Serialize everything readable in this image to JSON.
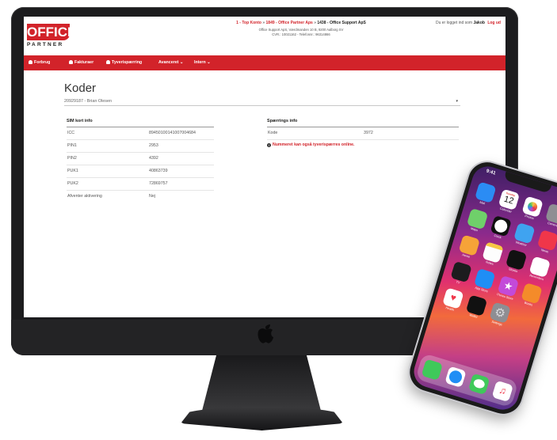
{
  "header": {
    "logo_main": "OFFICE",
    "logo_sub": "PARTNER",
    "breadcrumb": {
      "part1": "1 - Top Konto",
      "sep1": " » ",
      "part2": "1849 - Office Partner Aps",
      "sep2": " » ",
      "part3": "1438 - Office Support ApS"
    },
    "address_line1": "Office Support ApS, Værdmanden 10 B, 9200 Aalborg SV",
    "address_line2": "CVR.: 10021162 - Telefonnr.: 96314866",
    "logged_in_text": "Du er logget ind som",
    "user_name": "Jakob",
    "logout_label": "Log ud"
  },
  "nav": {
    "items": [
      {
        "label": "Forbrug"
      },
      {
        "label": "Fakturaer"
      },
      {
        "label": "Tyverispærring"
      },
      {
        "label": "Avanceret ⌄"
      },
      {
        "label": "Intern ⌄"
      }
    ]
  },
  "main": {
    "title": "Koder",
    "selected_subscriber": "20929187 - Brian Olesen",
    "sim_panel": {
      "heading": "SIM kort info",
      "rows": [
        {
          "label": "ICC",
          "value": "89450100141007004684"
        },
        {
          "label": "PIN1",
          "value": "2953"
        },
        {
          "label": "PIN2",
          "value": "4392"
        },
        {
          "label": "PUK1",
          "value": "40863739"
        },
        {
          "label": "PUK2",
          "value": "72869757"
        },
        {
          "label": "Afventer aktivering",
          "value": "Nej"
        }
      ]
    },
    "block_panel": {
      "heading": "Spærrings info",
      "rows": [
        {
          "label": "Kode",
          "value": "3972"
        }
      ],
      "note": "Nummeret kan også tyverispærres online."
    }
  },
  "phone": {
    "time": "9:41",
    "calendar_day": "Tuesday",
    "calendar_date": "12",
    "apps": [
      "Mail",
      "Calendar",
      "Photos",
      "Camera",
      "Maps",
      "Clock",
      "Weather",
      "News",
      "Home",
      "Notes",
      "Stocks",
      "Reminders",
      "TV",
      "App Store",
      "iTunes Store",
      "Books",
      "Health",
      "Wallet",
      "Settings"
    ],
    "dock_apps": [
      "Phone",
      "Safari",
      "Messages",
      "Music"
    ]
  },
  "colors": {
    "brand_red": "#d2232a",
    "device_dark": "#1c1c1e"
  }
}
